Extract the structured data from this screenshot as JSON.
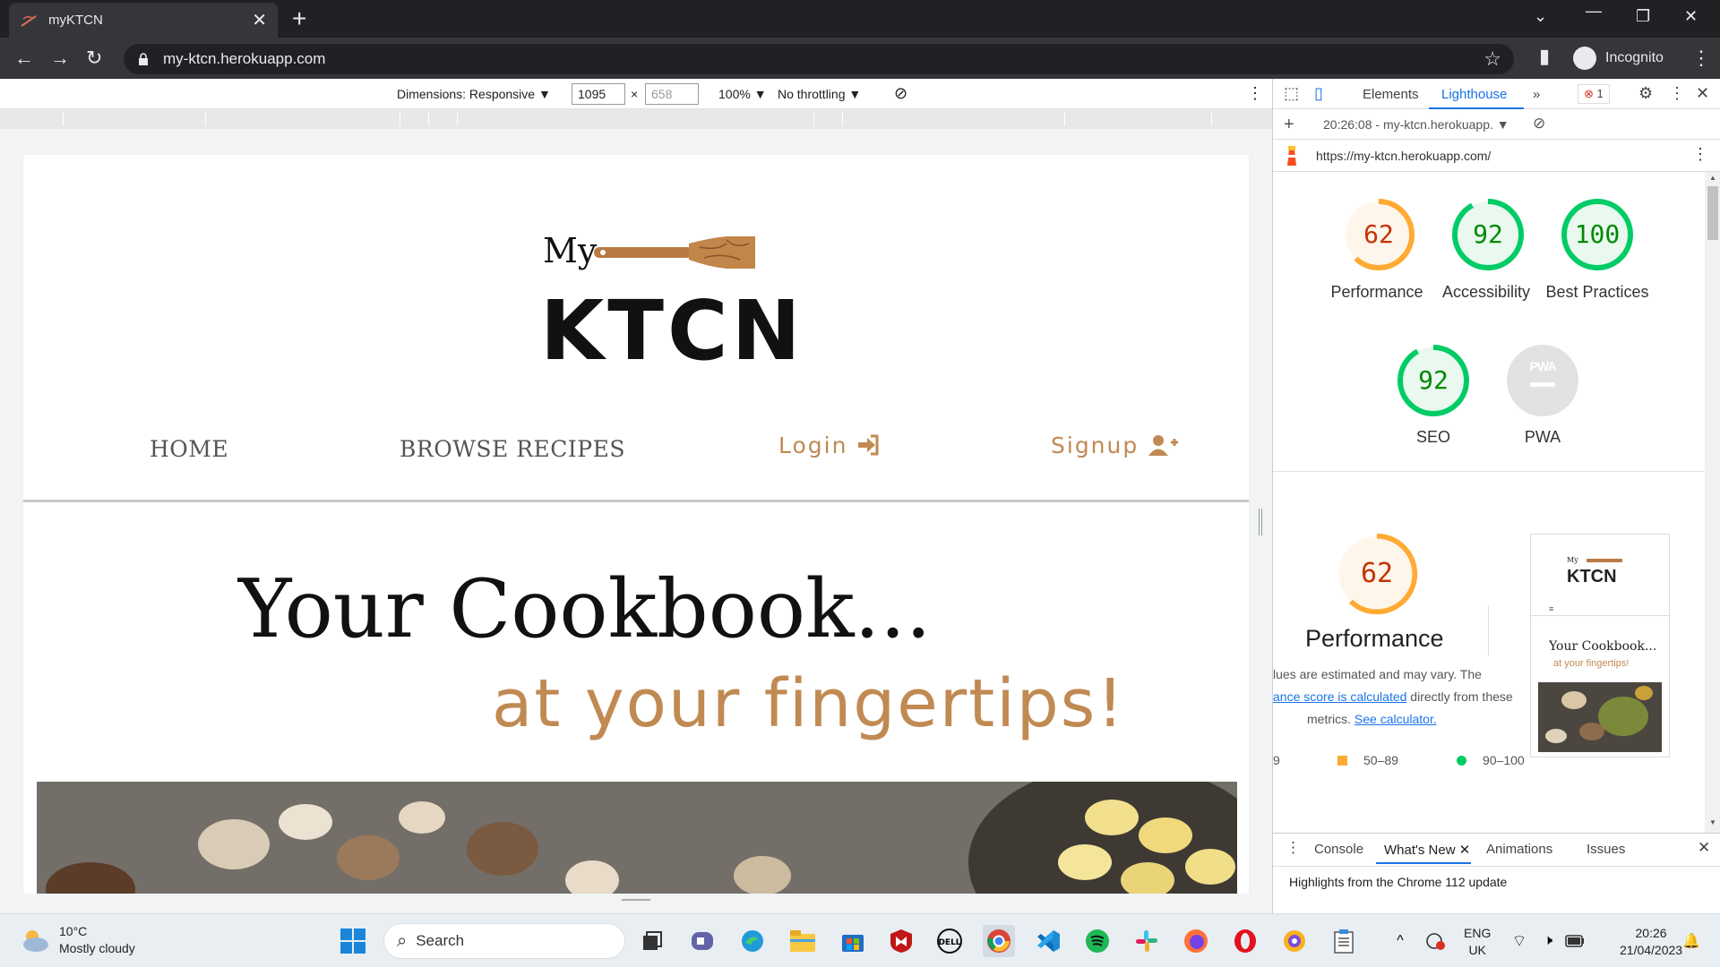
{
  "browser": {
    "tab_title": "myKTCN",
    "url": "my-ktcn.herokuapp.com",
    "profile_label": "Incognito"
  },
  "device_toolbar": {
    "dimensions_label": "Dimensions: Responsive",
    "width": "1095",
    "height": "658",
    "times": "×",
    "zoom": "100%",
    "throttling": "No throttling"
  },
  "site": {
    "logo_my": "My",
    "logo_ktcn": "KTCN",
    "nav": {
      "home": "HOME",
      "browse": "BROWSE RECIPES",
      "login": "Login",
      "signup": "Signup"
    },
    "hero_title": "Your Cookbook...",
    "hero_subtitle": "at your fingertips!"
  },
  "devtools": {
    "tabs": [
      "Elements",
      "Lighthouse"
    ],
    "error_count": "1",
    "report_label": "20:26:08 - my-ktcn.herokuapp.",
    "report_url": "https://my-ktcn.herokuapp.com/",
    "scores": [
      {
        "value": "62",
        "label": "Performance",
        "fraction": 0.62,
        "color": "#fa3"
      },
      {
        "value": "92",
        "label": "Accessibility",
        "fraction": 0.92,
        "color": "#0c6"
      },
      {
        "value": "100",
        "label": "Best Practices",
        "fraction": 1.0,
        "color": "#0c6"
      },
      {
        "value": "92",
        "label": "SEO",
        "fraction": 0.92,
        "color": "#0c6"
      },
      {
        "value": "",
        "label": "PWA",
        "fraction": 0,
        "color": "#999"
      }
    ],
    "pwa_badge": "PWA",
    "perf_big_score": "62",
    "perf_big_label": "Performance",
    "perf_note_line1": "lues are estimated and may vary. The",
    "perf_note_link": "ance score is calculated",
    "perf_note_line2_rest": " directly from these",
    "perf_note_line3_prefix": "metrics. ",
    "perf_note_calc": "See calculator.",
    "legend_low": "9",
    "legend_mid": "50–89",
    "legend_high": "90–100",
    "thumb_logo_my": "My",
    "thumb_logo_ktcn": "KTCN",
    "thumb_title": "Your Cookbook...",
    "thumb_sub": "at your fingertips!",
    "drawer_tabs": [
      "Console",
      "What's New",
      "Animations",
      "Issues"
    ],
    "drawer_text": "Highlights from the Chrome 112 update"
  },
  "taskbar": {
    "temp": "10°C",
    "weather": "Mostly cloudy",
    "search_label": "Search",
    "lang": "ENG",
    "region": "UK",
    "time": "20:26",
    "date": "21/04/2023"
  }
}
